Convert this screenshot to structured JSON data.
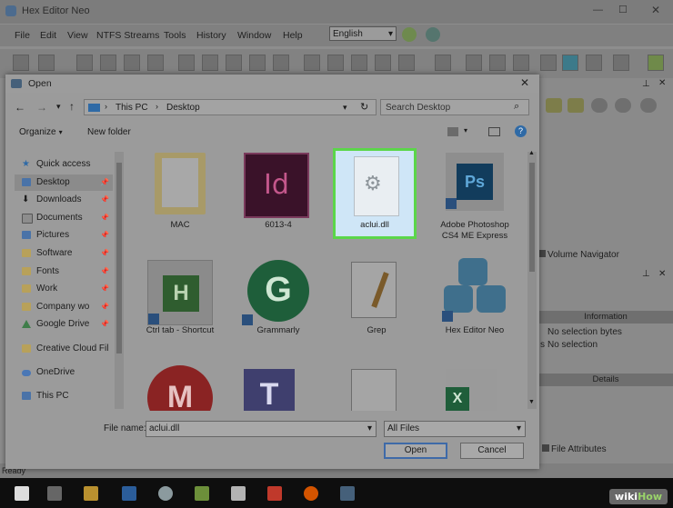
{
  "app": {
    "title": "Hex Editor Neo",
    "menu": [
      "File",
      "Edit",
      "View",
      "NTFS Streams",
      "Tools",
      "History",
      "Window",
      "Help"
    ],
    "language": "English",
    "status": "Ready",
    "panels": {
      "volume_navigator": "Volume Navigator",
      "information": "Information",
      "no_selection_1": "No selection",
      "no_selection_2": "No selection",
      "bytes": "bytes",
      "s": "s",
      "details": "Details",
      "file_attributes": "File Attributes"
    }
  },
  "dialog": {
    "title": "Open",
    "breadcrumb": [
      "This PC",
      "Desktop"
    ],
    "search_placeholder": "Search Desktop",
    "organize": "Organize",
    "new_folder": "New folder",
    "nav": [
      {
        "label": "Quick access",
        "icon": "star-icon"
      },
      {
        "label": "Desktop",
        "icon": "desktop-icon"
      },
      {
        "label": "Downloads",
        "icon": "download-icon"
      },
      {
        "label": "Documents",
        "icon": "documents-icon"
      },
      {
        "label": "Pictures",
        "icon": "pictures-icon"
      },
      {
        "label": "Software",
        "icon": "folder-icon"
      },
      {
        "label": "Fonts",
        "icon": "folder-icon"
      },
      {
        "label": "Work",
        "icon": "folder-icon"
      },
      {
        "label": "Company wo",
        "icon": "folder-icon"
      },
      {
        "label": "Google Drive",
        "icon": "google-drive-icon"
      },
      {
        "label": "Creative Cloud Fil",
        "icon": "creative-cloud-icon"
      },
      {
        "label": "OneDrive",
        "icon": "onedrive-icon"
      },
      {
        "label": "This PC",
        "icon": "computer-icon"
      }
    ],
    "files": [
      {
        "label": "MAC"
      },
      {
        "label": "6013-4"
      },
      {
        "label": "aclui.dll"
      },
      {
        "label": "Adobe Photoshop CS4 ME Express"
      },
      {
        "label": "Ctrl tab - Shortcut"
      },
      {
        "label": "Grammarly"
      },
      {
        "label": "Grep"
      },
      {
        "label": "Hex Editor Neo"
      },
      {
        "label": ""
      },
      {
        "label": ""
      },
      {
        "label": ""
      },
      {
        "label": ""
      }
    ],
    "file_name_label": "File name:",
    "file_name_value": "aclui.dll",
    "file_type": "All Files",
    "open_button": "Open",
    "cancel_button": "Cancel"
  },
  "watermark": {
    "wiki": "wiki",
    "how": "How"
  },
  "colors": {
    "selection_highlight": "#5bd64a",
    "selection_fill": "#cfe6f7"
  }
}
